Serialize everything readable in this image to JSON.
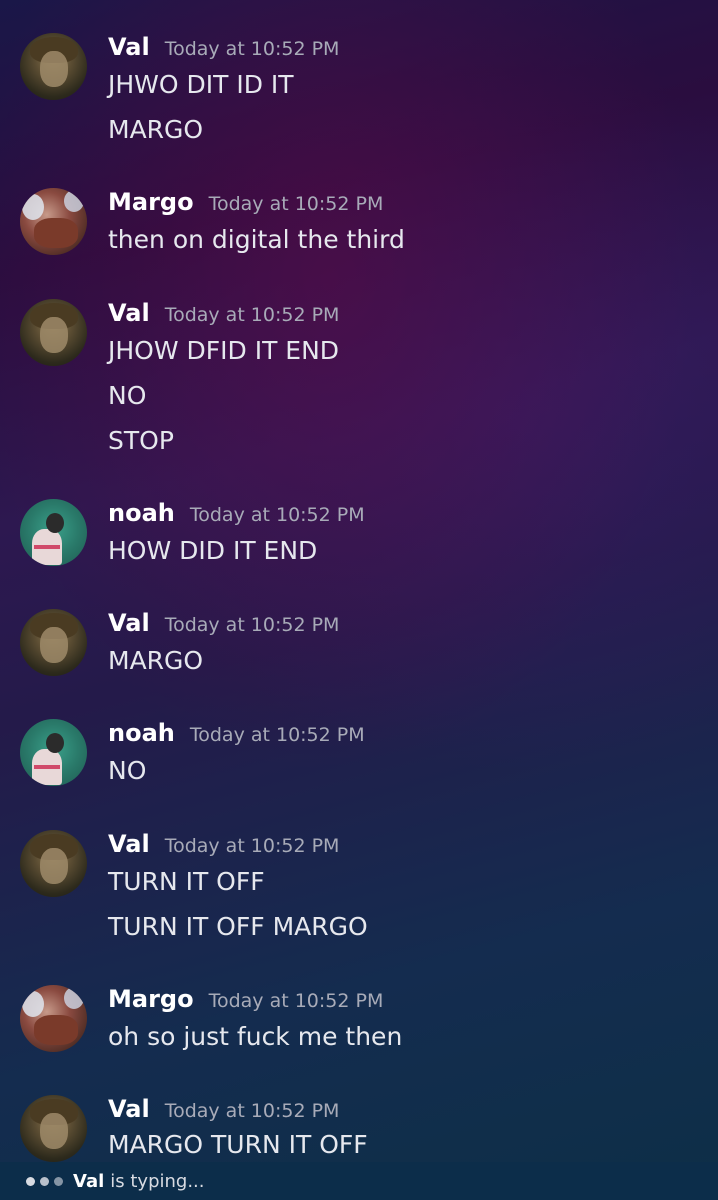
{
  "messages": [
    {
      "author": "Val",
      "time": "Today at 10:52 PM",
      "lines": [
        "JHWO DIT ID IT",
        "MARGO"
      ]
    },
    {
      "author": "Margo",
      "time": "Today at 10:52 PM",
      "lines": [
        "then on digital the third"
      ]
    },
    {
      "author": "Val",
      "time": "Today at 10:52 PM",
      "lines": [
        "JHOW DFID IT END",
        "NO",
        "STOP"
      ]
    },
    {
      "author": "noah",
      "time": "Today at 10:52 PM",
      "lines": [
        "HOW DID IT END"
      ]
    },
    {
      "author": "Val",
      "time": "Today at 10:52 PM",
      "lines": [
        "MARGO"
      ]
    },
    {
      "author": "noah",
      "time": "Today at 10:52 PM",
      "lines": [
        "NO"
      ]
    },
    {
      "author": "Val",
      "time": "Today at 10:52 PM",
      "lines": [
        "TURN IT OFF",
        "TURN IT OFF MARGO"
      ]
    },
    {
      "author": "Margo",
      "time": "Today at 10:52 PM",
      "lines": [
        "oh so just fuck me then"
      ]
    },
    {
      "author": "Val",
      "time": "Today at 10:52 PM",
      "lines": [
        "MARGO TURN IT OFF"
      ]
    }
  ],
  "typing": {
    "user": "Val",
    "text": "is typing..."
  },
  "icons": {
    "typing": "typing-dots-icon",
    "avatar_val": "val-avatar",
    "avatar_margo": "margo-avatar",
    "avatar_noah": "noah-avatar"
  }
}
